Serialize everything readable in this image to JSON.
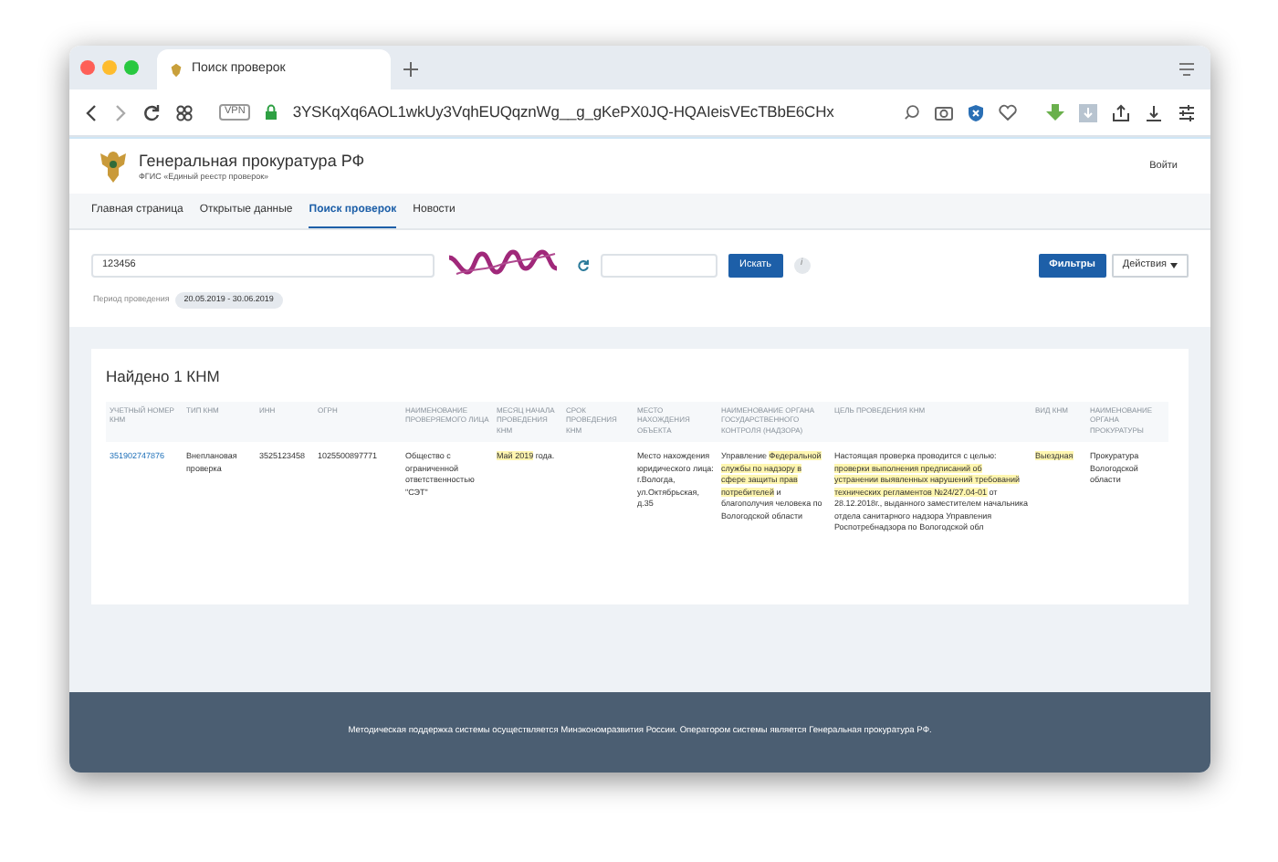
{
  "browser": {
    "tab_title": "Поиск проверок",
    "vpn_label": "VPN",
    "url": "3YSKqXq6AOL1wkUy3VqhEUQqznWg__g_gKePX0JQ-HQAIeisVEcTBbE6CHx"
  },
  "header": {
    "title": "Генеральная прокуратура РФ",
    "subtitle": "ФГИС «Единый реестр проверок»",
    "login": "Войти"
  },
  "nav": [
    {
      "label": "Главная страница",
      "selected": false
    },
    {
      "label": "Открытые данные",
      "selected": false
    },
    {
      "label": "Поиск проверок",
      "selected": true
    },
    {
      "label": "Новости",
      "selected": false
    }
  ],
  "search": {
    "value": "123456",
    "search_button": "Искать",
    "info": "i",
    "filters_button": "Фильтры",
    "actions_button": "Действия"
  },
  "period": {
    "label": "Период проведения",
    "value": "20.05.2019 - 30.06.2019"
  },
  "results": {
    "title": "Найдено 1 КНМ",
    "columns": [
      "УЧЕТНЫЙ НОМЕР КНМ",
      "ТИП КНМ",
      "ИНН",
      "ОГРН",
      "НАИМЕНОВАНИЕ ПРОВЕРЯЕМОГО ЛИЦА",
      "МЕСЯЦ НАЧАЛА ПРОВЕДЕНИЯ КНМ",
      "СРОК ПРОВЕДЕНИЯ КНМ",
      "МЕСТО НАХОЖДЕНИЯ ОБЪЕКТА",
      "НАИМЕНОВАНИЕ ОРГАНА ГОСУДАРСТВЕННОГО КОНТРОЛЯ (НАДЗОРА)",
      "ЦЕЛЬ ПРОВЕДЕНИЯ КНМ",
      "ВИД КНМ",
      "НАИМЕНОВАНИЕ ОРГАНА ПРОКУРАТУРЫ"
    ],
    "rows": [
      {
        "cells": [
          {
            "kind": "link",
            "segments": [
              {
                "text": "351902747876",
                "highlighted": false
              }
            ]
          },
          {
            "kind": "text",
            "segments": [
              {
                "text": "Внеплановая проверка",
                "highlighted": false
              }
            ]
          },
          {
            "kind": "text",
            "segments": [
              {
                "text": "3525123458",
                "highlighted": false
              }
            ]
          },
          {
            "kind": "text",
            "segments": [
              {
                "text": "1025500897771",
                "highlighted": false
              }
            ]
          },
          {
            "kind": "text",
            "segments": [
              {
                "text": "Общество с ограниченной ответственностью \"СЭТ\"",
                "highlighted": false
              }
            ]
          },
          {
            "kind": "text",
            "segments": [
              {
                "text": "Май 2019",
                "highlighted": true
              },
              {
                "text": " года.",
                "highlighted": false
              }
            ]
          },
          {
            "kind": "empty"
          },
          {
            "kind": "text",
            "segments": [
              {
                "text": "Место нахождения юридического лица: г.Вологда, ул.Октябрьская, д.35",
                "highlighted": false
              }
            ]
          },
          {
            "kind": "text",
            "segments": [
              {
                "text": "Управление ",
                "highlighted": false
              },
              {
                "text": "Федеральной службы по надзору в сфере защиты прав потребителей",
                "highlighted": true
              },
              {
                "text": " и благополучия человека по Вологодской области",
                "highlighted": false
              }
            ]
          },
          {
            "kind": "text",
            "segments": [
              {
                "text": "Настоящая проверка проводится с целью: ",
                "highlighted": false
              },
              {
                "text": "проверки выполнения предписаний об устранении выявленных нарушений требований технических регламентов №24/27.04-01",
                "highlighted": true
              },
              {
                "text": " от 28.12.2018г., выданного заместителем начальника отдела санитарного надзора Управления Роспотребнадзора по Вологодской обл",
                "highlighted": false
              }
            ]
          },
          {
            "kind": "text",
            "segments": [
              {
                "text": "Выездная",
                "highlighted": true
              }
            ]
          },
          {
            "kind": "text",
            "segments": [
              {
                "text": "Прокуратура Вологодской области",
                "highlighted": false
              }
            ]
          }
        ]
      }
    ]
  },
  "footer": {
    "text": "Методическая поддержка системы осуществляется Минэкономразвития России. Оператором системы является Генеральная прокуратура РФ."
  }
}
